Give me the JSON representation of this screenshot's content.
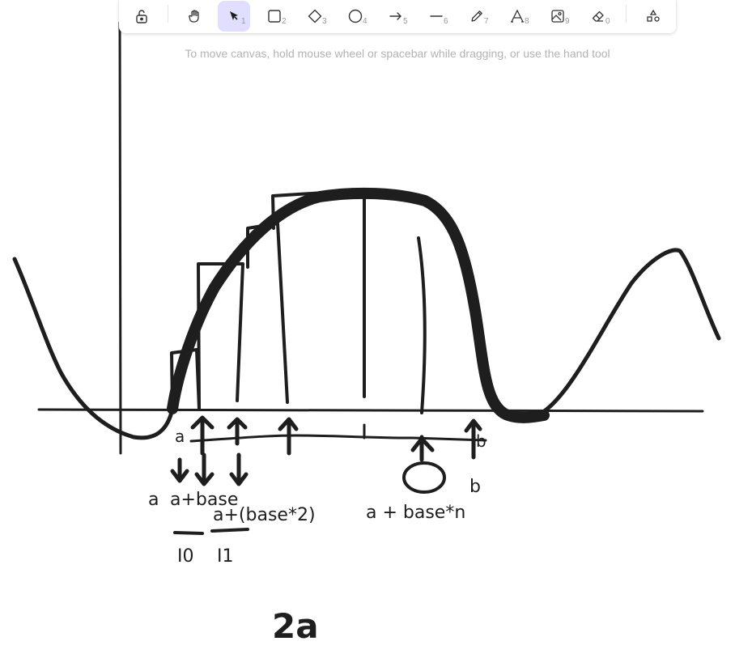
{
  "toolbar": {
    "tools": [
      {
        "name": "lock",
        "key": ""
      },
      {
        "name": "hand",
        "key": ""
      },
      {
        "name": "selection",
        "key": "1"
      },
      {
        "name": "rectangle",
        "key": "2"
      },
      {
        "name": "diamond",
        "key": "3"
      },
      {
        "name": "ellipse",
        "key": "4"
      },
      {
        "name": "arrow",
        "key": "5"
      },
      {
        "name": "line",
        "key": "6"
      },
      {
        "name": "draw",
        "key": "7"
      },
      {
        "name": "text",
        "key": "8"
      },
      {
        "name": "image",
        "key": "9"
      },
      {
        "name": "eraser",
        "key": "0"
      },
      {
        "name": "more-shapes",
        "key": ""
      }
    ],
    "active_tool": "selection",
    "accent_color": "#e0dfff"
  },
  "hint": "To move canvas, hold mouse wheel or spacebar while dragging, or use the hand tool",
  "canvas": {
    "stroke_color": "#1e1e1e",
    "labels": {
      "a_axis": "a",
      "b_axis": "b",
      "b_lower": "b",
      "a_lower": "a",
      "a_plus_base": "a+base",
      "a_plus_base2": "a+(base*2)",
      "a_plus_basen": "a + base*n",
      "i0": "I0",
      "i1": "I1",
      "two_a": "2a"
    }
  }
}
